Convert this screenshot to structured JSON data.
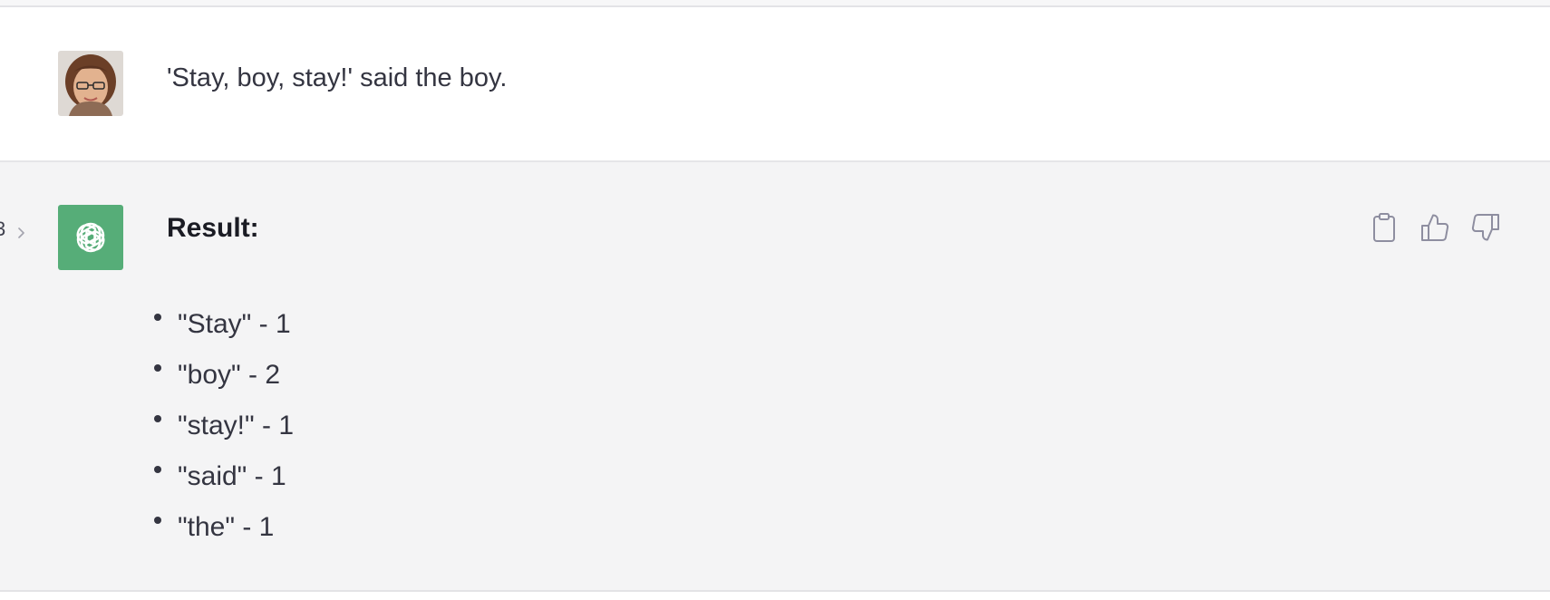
{
  "user_message": {
    "text": "'Stay, boy, stay!' said the boy."
  },
  "conversation_nav": {
    "fragment": "3",
    "icon": "chevron-right-icon"
  },
  "assistant_message": {
    "title": "Result:",
    "items": [
      "\"Stay\" - 1",
      "\"boy\" - 2",
      "\"stay!\" - 1",
      "\"said\" - 1",
      "\"the\" - 1"
    ],
    "avatar_color": "#56ad78"
  },
  "actions": {
    "icons": [
      "clipboard-icon",
      "thumbs-up-icon",
      "thumbs-down-icon"
    ]
  }
}
